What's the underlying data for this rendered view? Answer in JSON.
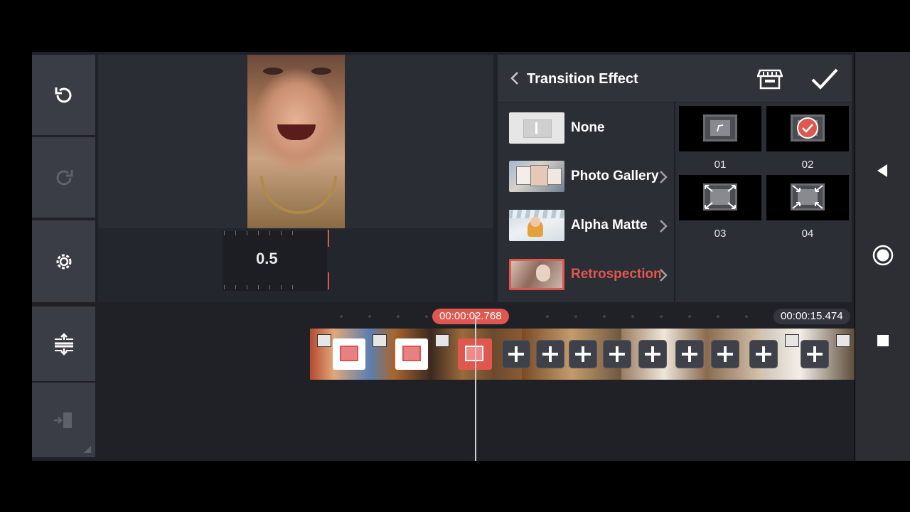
{
  "colors": {
    "accent": "#e0574f",
    "panel": "#2b2e35",
    "rail": "#3a3d45",
    "background": "#1f2127"
  },
  "left_rail": {
    "buttons": [
      {
        "icon": "undo-icon"
      },
      {
        "icon": "redo-icon"
      },
      {
        "icon": "settings-gear-icon"
      }
    ],
    "timeline_buttons": [
      {
        "icon": "track-adjust-icon"
      },
      {
        "icon": "export-icon"
      }
    ]
  },
  "preview": {
    "speed_value": "0.5"
  },
  "panel": {
    "title": "Transition Effect",
    "categories": [
      {
        "label": "None",
        "selected": false
      },
      {
        "label": "Photo Gallery",
        "selected": false
      },
      {
        "label": "Alpha Matte",
        "selected": false
      },
      {
        "label": "Retrospection",
        "selected": true
      }
    ],
    "effects": [
      {
        "label": "01",
        "selected": false
      },
      {
        "label": "02",
        "selected": true
      },
      {
        "label": "03",
        "selected": false
      },
      {
        "label": "04",
        "selected": false
      }
    ]
  },
  "timeline": {
    "current_time": "00:00:02.768",
    "total_time": "00:00:15.474"
  },
  "nav_bar": {
    "icons": [
      "back-triangle-icon",
      "home-circle-icon",
      "recents-square-icon"
    ]
  }
}
